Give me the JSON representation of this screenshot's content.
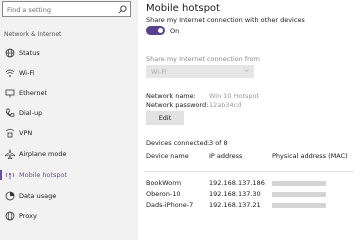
{
  "sidebar": {
    "search_placeholder": "Find a setting",
    "section_title": "Network & Internet",
    "items": [
      {
        "label": "Status",
        "icon": "globe-icon"
      },
      {
        "label": "Wi-Fi",
        "icon": "wifi-icon"
      },
      {
        "label": "Ethernet",
        "icon": "ethernet-icon"
      },
      {
        "label": "Dial-up",
        "icon": "phone-icon"
      },
      {
        "label": "VPN",
        "icon": "vpn-icon"
      },
      {
        "label": "Airplane mode",
        "icon": "airplane-icon"
      },
      {
        "label": "Mobile hotspot",
        "icon": "hotspot-icon",
        "active": true
      },
      {
        "label": "Data usage",
        "icon": "data-usage-icon"
      },
      {
        "label": "Proxy",
        "icon": "proxy-icon"
      }
    ],
    "accent": "#6b4ea0"
  },
  "main": {
    "title": "Mobile hotspot",
    "share_text": "Share my Internet connection with other devices",
    "toggle_label": "On",
    "toggle_on": true,
    "share_from_label": "Share my Internet connection from",
    "share_from_value": "Wi-Fi",
    "network_name_label": "Network name:",
    "network_name_value": "Win 10 Hotspot",
    "password_label": "Network password:",
    "password_value": "12ab34cd",
    "edit_label": "Edit",
    "devices_connected_label": "Devices connected:",
    "devices_connected_value": "3 of 8",
    "table": {
      "headers": [
        "Device name",
        "IP address",
        "Physical address (MAC)"
      ],
      "rows": [
        {
          "name": "BookWorm",
          "ip": "192.168.137.186"
        },
        {
          "name": "Oberon-10",
          "ip": "192.168.137.30"
        },
        {
          "name": "Dads-iPhone-7",
          "ip": "192.168.137.21"
        }
      ]
    },
    "accent": "#5b3f8f"
  }
}
